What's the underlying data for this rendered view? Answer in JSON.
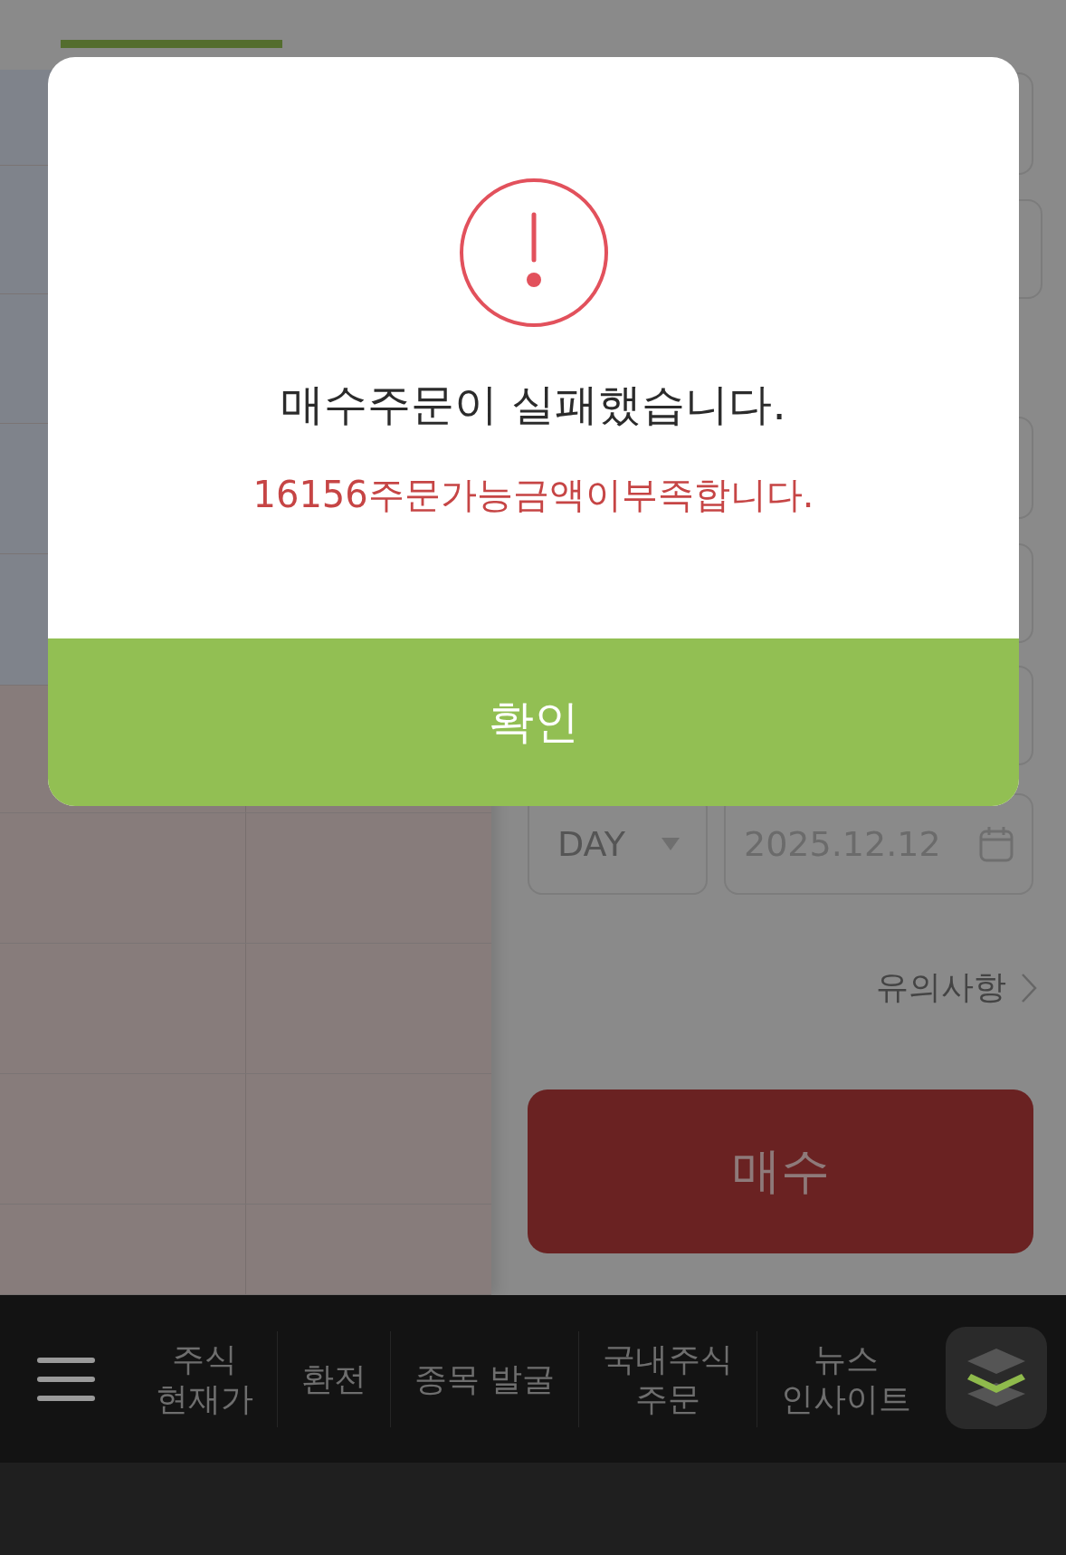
{
  "order_form": {
    "order_type": "DAY",
    "date": "2025.12.12",
    "notice_link": "유의사항",
    "buy_button": "매수"
  },
  "bottom_nav": {
    "items": [
      {
        "lines": [
          "주식",
          "현재가"
        ]
      },
      {
        "lines": [
          "환전"
        ]
      },
      {
        "lines": [
          "종목 발굴"
        ]
      },
      {
        "lines": [
          "국내주식",
          "주문"
        ]
      },
      {
        "lines": [
          "뉴스",
          "인사이트"
        ]
      }
    ]
  },
  "dialog": {
    "title": "매수주문이 실패했습니다.",
    "message": "16156주문가능금액이부족합니다.",
    "confirm_button": "확인"
  }
}
